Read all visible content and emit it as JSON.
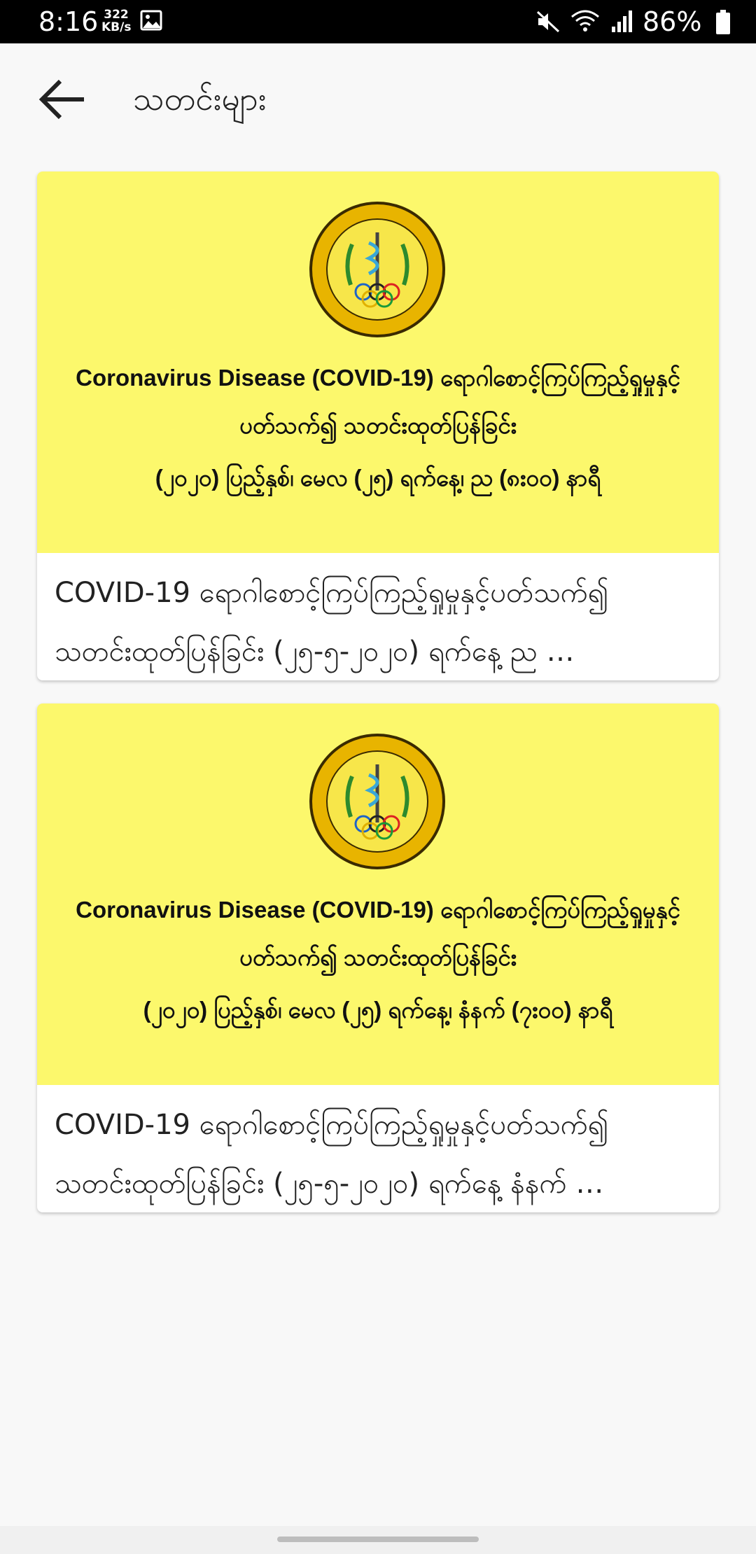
{
  "status_bar": {
    "time": "8:16",
    "speed_value": "322",
    "speed_unit": "KB/s",
    "battery": "86%",
    "icons": [
      "image-icon",
      "mute-icon",
      "wifi-icon",
      "signal-icon",
      "battery-icon"
    ]
  },
  "app_bar": {
    "title": "သတင်းများ",
    "back_icon": "arrow-left-icon"
  },
  "news": [
    {
      "logo_alt": "Ministry of Health and Sports seal",
      "banner_line1": "Coronavirus Disease (COVID-19) ရောဂါစောင့်ကြပ်ကြည့်ရှုမှုနှင့်",
      "banner_line2": "ပတ်သက်၍ သတင်းထုတ်ပြန်ခြင်း",
      "banner_line3": "(၂၀၂၀) ပြည့်နှစ်၊ မေလ (၂၅) ရက်နေ့၊ ည (၈း၀၀) နာရီ",
      "summary_line1": "COVID-19 ရောဂါစောင့်ကြပ်ကြည့်ရှုမှုနှင့်ပတ်သက်၍",
      "summary_line2": "သတင်းထုတ်ပြန်ခြင်း (၂၅-၅-၂၀၂၀)  ရက်နေ့  ည …"
    },
    {
      "logo_alt": "Ministry of Health and Sports seal",
      "banner_line1": "Coronavirus Disease (COVID-19) ရောဂါစောင့်ကြပ်ကြည့်ရှုမှုနှင့်",
      "banner_line2": "ပတ်သက်၍ သတင်းထုတ်ပြန်ခြင်း",
      "banner_line3": "(၂၀၂၀) ပြည့်နှစ်၊ မေလ (၂၅) ရက်နေ့၊ နံနက် (၇း၀၀) နာရီ",
      "summary_line1": "COVID-19 ရောဂါစောင့်ကြပ်ကြည့်ရှုမှုနှင့်ပတ်သက်၍",
      "summary_line2": "သတင်းထုတ်ပြန်ခြင်း (၂၅-၅-၂၀၂၀)  ရက်နေ့  နံနက် …"
    }
  ],
  "colors": {
    "banner_bg": "#fcf86c",
    "card_bg": "#ffffff",
    "page_bg": "#f8f8f8",
    "logo_gold": "#e8b400"
  }
}
